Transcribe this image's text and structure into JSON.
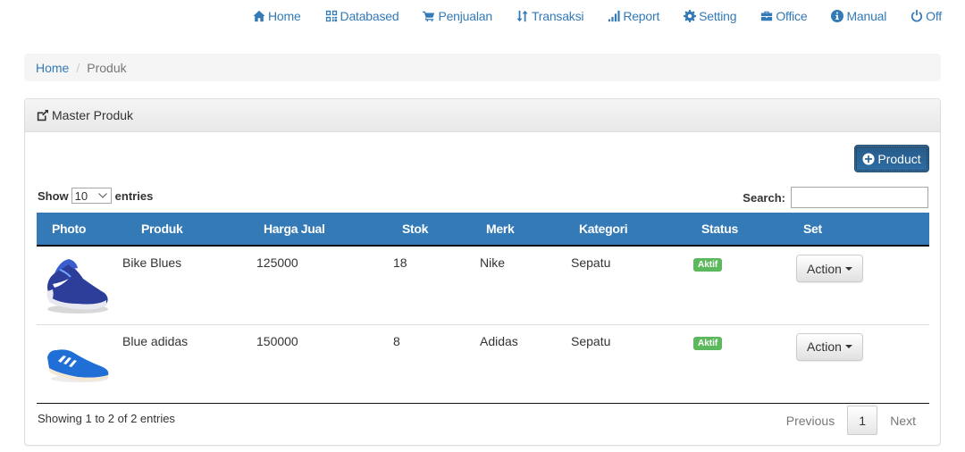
{
  "nav": [
    {
      "icon": "home-icon",
      "label": "Home"
    },
    {
      "icon": "qrcode-icon",
      "label": "Databased"
    },
    {
      "icon": "shopping-cart-icon",
      "label": "Penjualan"
    },
    {
      "icon": "sort-icon",
      "label": "Transaksi"
    },
    {
      "icon": "signal-icon",
      "label": "Report"
    },
    {
      "icon": "cog-icon",
      "label": "Setting"
    },
    {
      "icon": "briefcase-icon",
      "label": "Office"
    },
    {
      "icon": "info-sign-icon",
      "label": "Manual"
    },
    {
      "icon": "power-icon",
      "label": "Off"
    }
  ],
  "breadcrumb": {
    "home": "Home",
    "separator": "/",
    "current": "Produk"
  },
  "panel": {
    "title": "Master Produk",
    "add_button": "Product"
  },
  "table_controls": {
    "show_label": "Show",
    "entries_label": "entries",
    "page_length": "10",
    "search_label": "Search:",
    "search_value": ""
  },
  "table": {
    "headers": [
      "Photo",
      "Produk",
      "Harga Jual",
      "Stok",
      "Merk",
      "Kategori",
      "Status",
      "Set"
    ],
    "rows": [
      {
        "photo": "nike-shoe-image",
        "produk": "Bike Blues",
        "harga": "125000",
        "stok": "18",
        "merk": "Nike",
        "kategori": "Sepatu",
        "status": "Aktif",
        "action": "Action"
      },
      {
        "photo": "adidas-shoe-image",
        "produk": "Blue adidas",
        "harga": "150000",
        "stok": "8",
        "merk": "Adidas",
        "kategori": "Sepatu",
        "status": "Aktif",
        "action": "Action"
      }
    ]
  },
  "footer": {
    "info": "Showing 1 to 2 of 2 entries",
    "previous": "Previous",
    "current_page": "1",
    "next": "Next"
  },
  "colors": {
    "primary": "#337ab7",
    "success": "#5cb85c",
    "primary_dark": "#286090"
  }
}
